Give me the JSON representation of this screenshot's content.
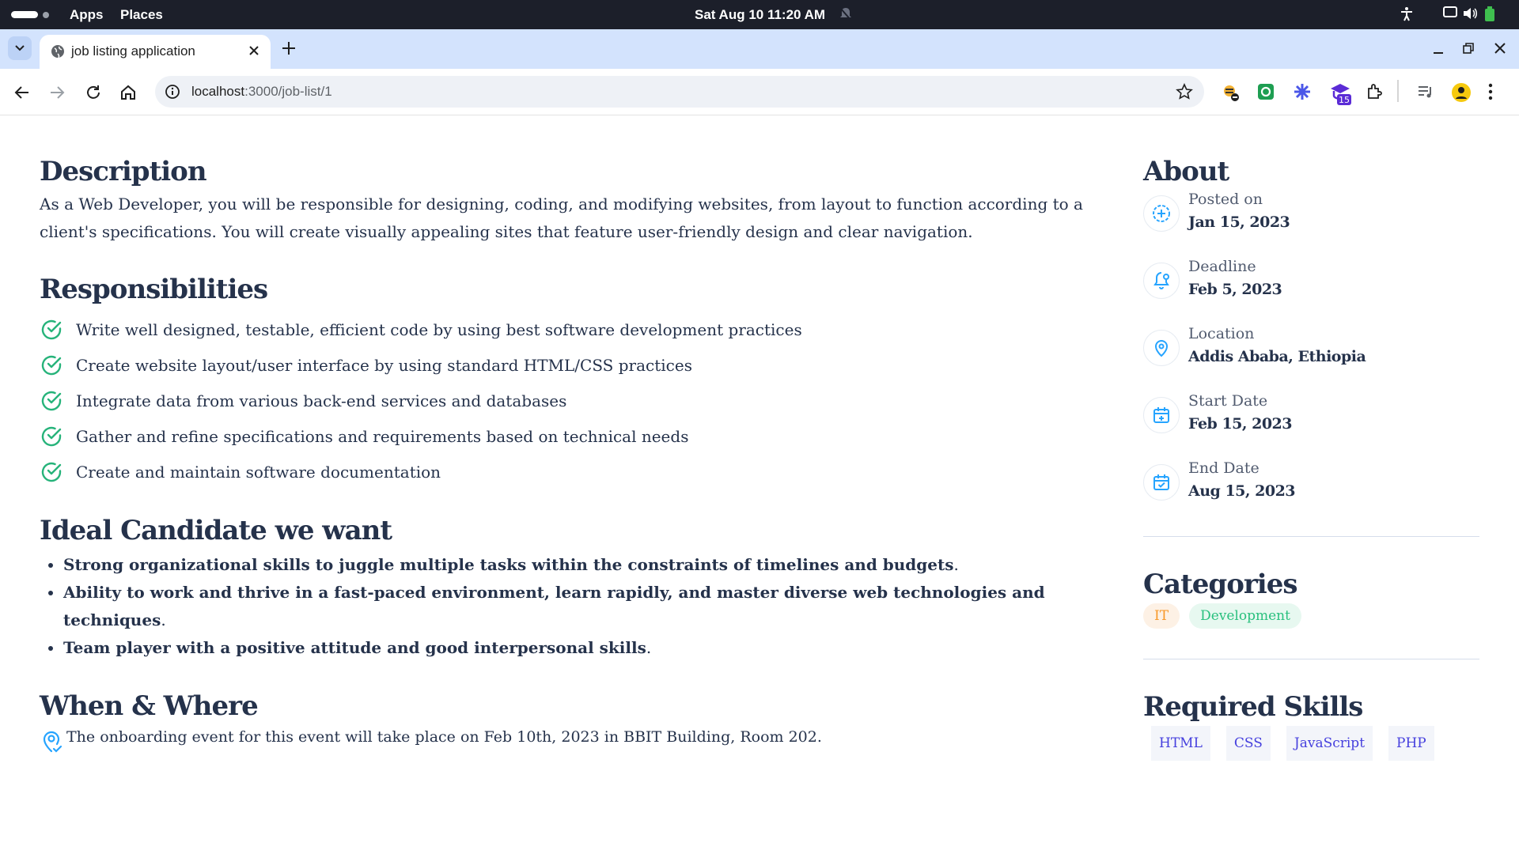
{
  "system_bar": {
    "apps_label": "Apps",
    "places_label": "Places",
    "clock": "Sat Aug 10  11:20 AM"
  },
  "browser": {
    "tab_title": "job listing application",
    "url_host": "localhost",
    "url_path": ":3000/job-list/1",
    "extension_badge": "15"
  },
  "colors": {
    "heading": "#25324b",
    "check_green": "#26b37a",
    "icon_teal": "#26a4ff",
    "tag_it": "#f89828",
    "tag_dev": "#29c07e",
    "skill_text": "#4640de"
  },
  "main": {
    "description": {
      "heading": "Description",
      "text": "As a Web Developer, you will be responsible for designing, coding, and modifying websites, from layout to function according to a client's specifications. You will create visually appealing sites that feature user-friendly design and clear navigation."
    },
    "responsibilities": {
      "heading": "Responsibilities",
      "items": [
        "Write well designed, testable, efficient code by using best software development practices",
        "Create website layout/user interface by using standard HTML/CSS practices",
        "Integrate data from various back-end services and databases",
        "Gather and refine specifications and requirements based on technical needs",
        "Create and maintain software documentation"
      ]
    },
    "ideal": {
      "heading": "Ideal Candidate we want",
      "items": [
        "Strong organizational skills to juggle multiple tasks within the constraints of timelines and budgets",
        "Ability to work and thrive in a fast-paced environment, learn rapidly, and master diverse web technologies and techniques",
        "Team player with a positive attitude and good interpersonal skills"
      ],
      "period": "."
    },
    "when_where": {
      "heading": "When & Where",
      "text": "The onboarding event for this event will take place on Feb 10th, 2023 in BBIT Building, Room 202."
    }
  },
  "side": {
    "about": {
      "heading": "About",
      "items": [
        {
          "label": "Posted on",
          "value": "Jan 15, 2023",
          "icon": "plus-circle-icon"
        },
        {
          "label": "Deadline",
          "value": "Feb 5, 2023",
          "icon": "bell-icon"
        },
        {
          "label": "Location",
          "value": "Addis Ababa, Ethiopia",
          "icon": "location-pin-icon"
        },
        {
          "label": "Start Date",
          "value": "Feb 15, 2023",
          "icon": "calendar-plus-icon"
        },
        {
          "label": "End Date",
          "value": "Aug 15, 2023",
          "icon": "calendar-check-icon"
        }
      ]
    },
    "categories": {
      "heading": "Categories",
      "items": [
        "IT",
        "Development"
      ]
    },
    "skills": {
      "heading": "Required Skills",
      "items": [
        "HTML",
        "CSS",
        "JavaScript",
        "PHP"
      ]
    }
  }
}
